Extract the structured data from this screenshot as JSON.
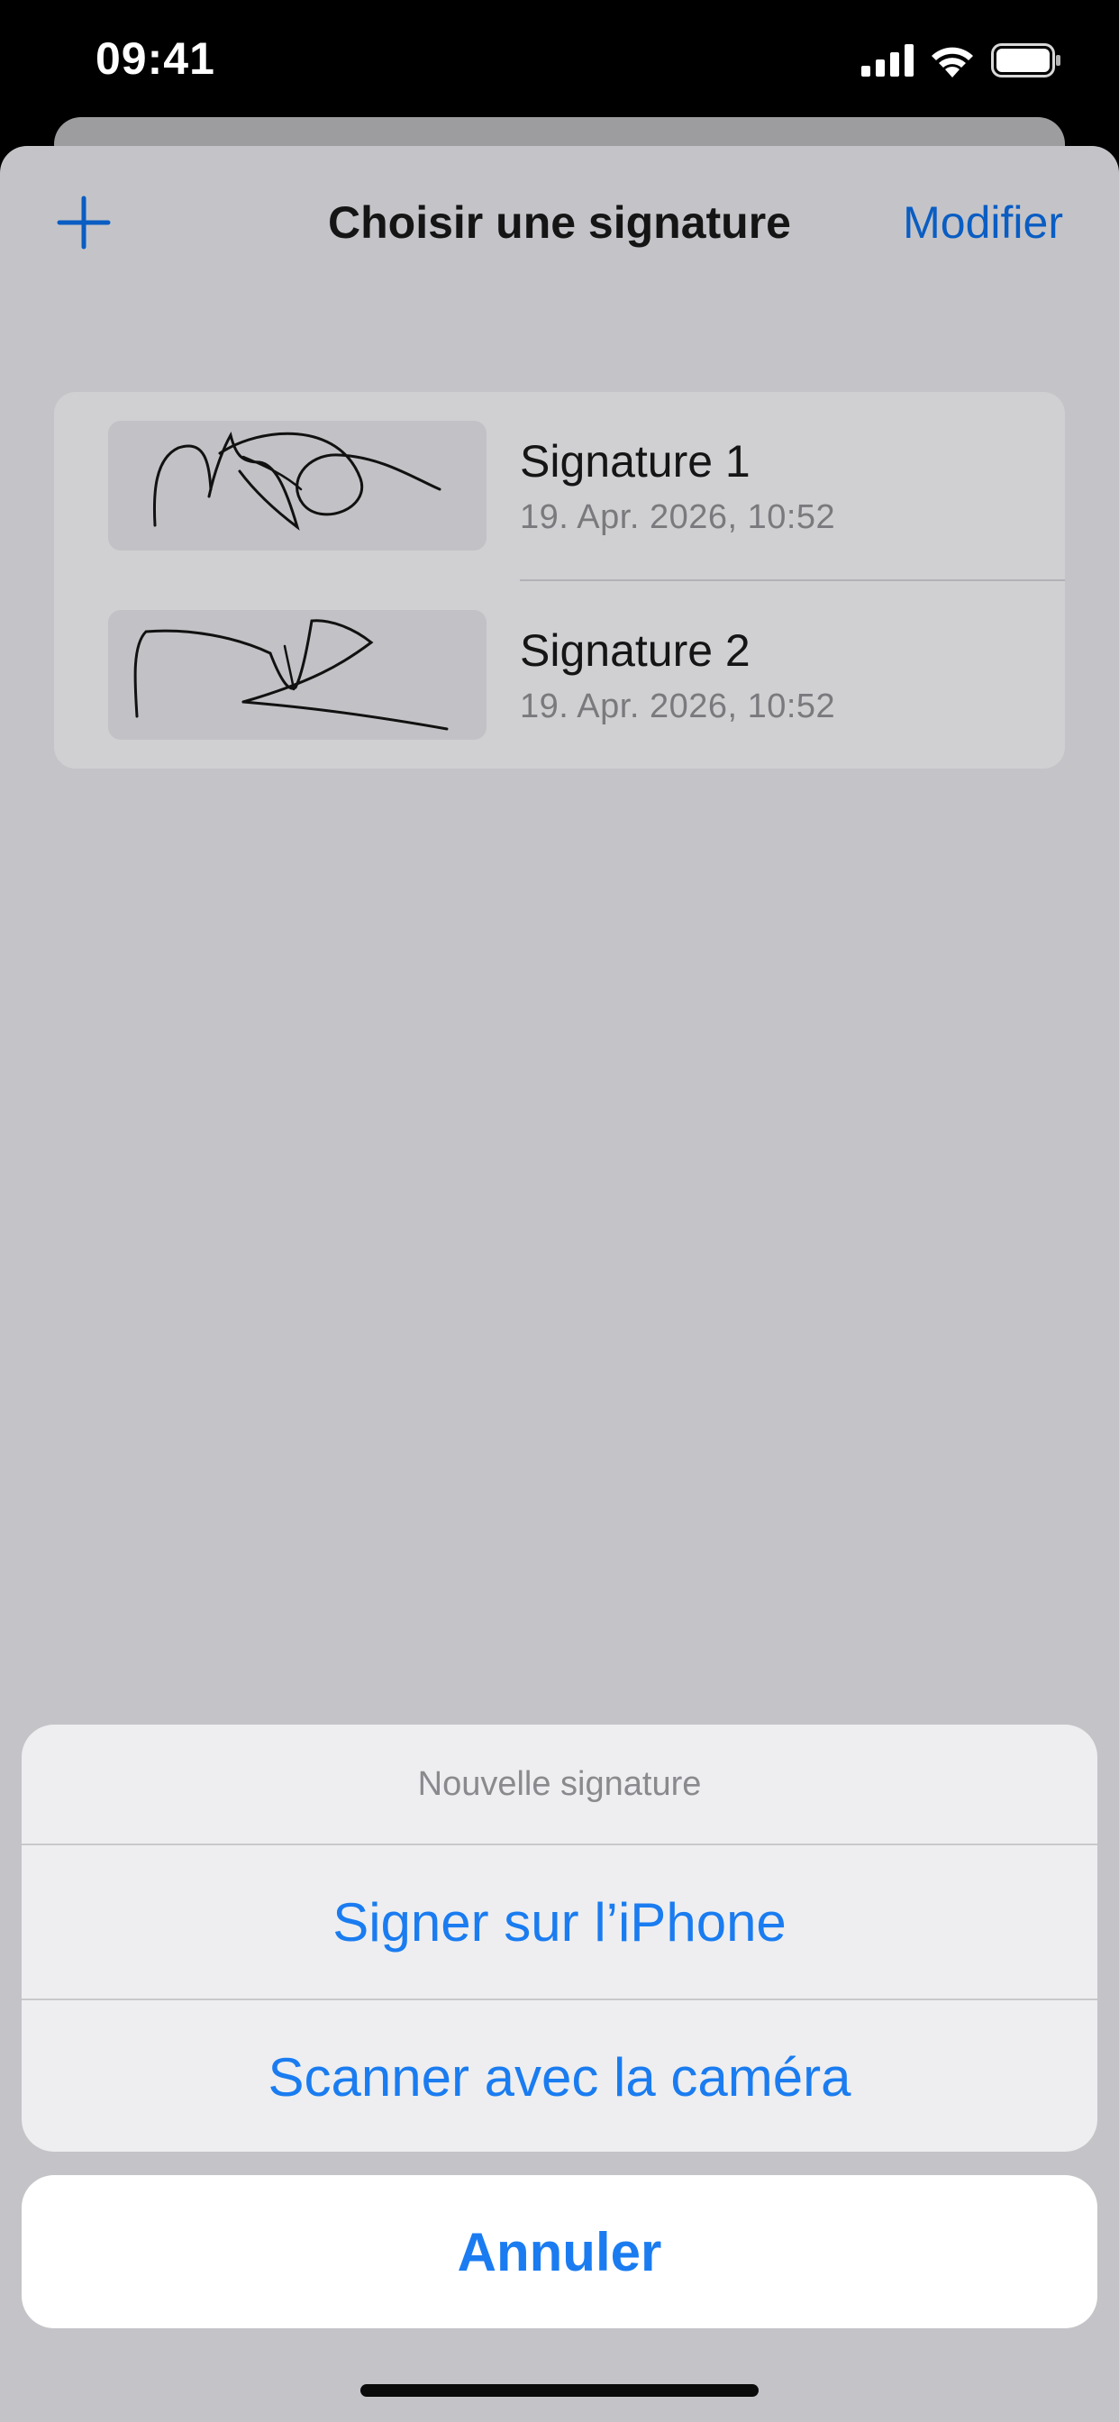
{
  "status_bar": {
    "time": "09:41",
    "icons": [
      "cellular-signal-icon",
      "wifi-icon",
      "battery-icon"
    ]
  },
  "nav": {
    "add_icon": "plus-icon",
    "title": "Choisir une signature",
    "edit_label": "Modifier"
  },
  "signatures": [
    {
      "title": "Signature 1",
      "date": "19. Apr. 2026, 10:52"
    },
    {
      "title": "Signature 2",
      "date": "19. Apr. 2026, 10:52"
    }
  ],
  "action_sheet": {
    "header": "Nouvelle signature",
    "actions": [
      {
        "label": "Signer sur l’iPhone"
      },
      {
        "label": "Scanner avec la caméra"
      }
    ],
    "cancel_label": "Annuler"
  },
  "colors": {
    "accent": "#1a7cf0",
    "nav_accent": "#0a5dc2",
    "dimmed_sheet": "#c4c4c8",
    "action_group_bg": "#eeeef0",
    "cancel_bg": "#ffffff"
  }
}
